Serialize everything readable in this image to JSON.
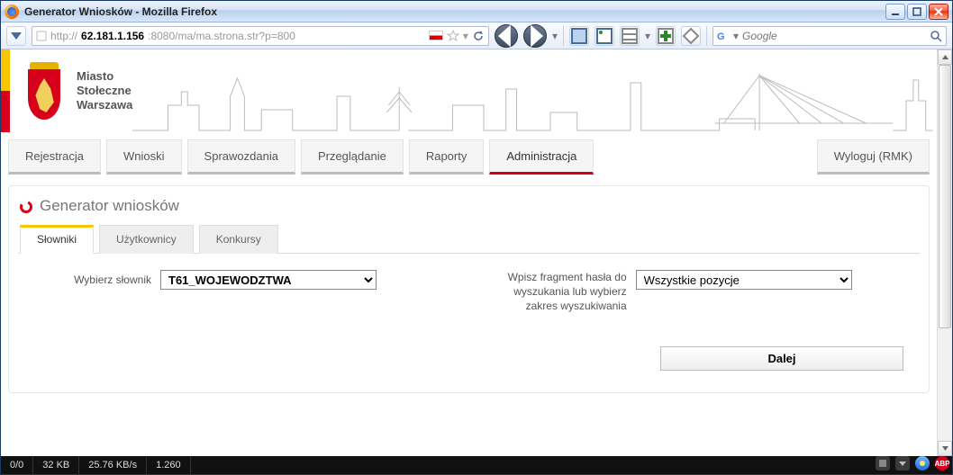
{
  "window": {
    "title": "Generator Wniosków - Mozilla Firefox"
  },
  "toolbar": {
    "url_prefix": "http://",
    "url_host": "62.181.1.156",
    "url_rest": ":8080/ma/ma.strona.str?p=800",
    "search_placeholder": "Google"
  },
  "banner": {
    "city_line1": "Miasto",
    "city_line2": "Stołeczne",
    "city_line3": "Warszawa"
  },
  "nav": {
    "items": [
      {
        "label": "Rejestracja",
        "active": false
      },
      {
        "label": "Wnioski",
        "active": false
      },
      {
        "label": "Sprawozdania",
        "active": false
      },
      {
        "label": "Przeglądanie",
        "active": false
      },
      {
        "label": "Raporty",
        "active": false
      },
      {
        "label": "Administracja",
        "active": true
      }
    ],
    "logout": "Wyloguj (RMK)"
  },
  "panel": {
    "title": "Generator wniosków",
    "tabs": [
      {
        "label": "Słowniki",
        "active": true
      },
      {
        "label": "Użytkownicy",
        "active": false
      },
      {
        "label": "Konkursy",
        "active": false
      }
    ],
    "form": {
      "dict_label": "Wybierz słownik",
      "dict_value": "T61_WOJEWODZTWA",
      "search_label": "Wpisz fragment hasła do wyszukania lub wybierz zakres wyszukiwania",
      "search_value": "Wszystkie pozycje",
      "next_label": "Dalej"
    }
  },
  "status": {
    "s1": "0/0",
    "s2": "32 KB",
    "s3": "25.76 KB/s",
    "s4": "1.260",
    "abp": "ABP"
  }
}
